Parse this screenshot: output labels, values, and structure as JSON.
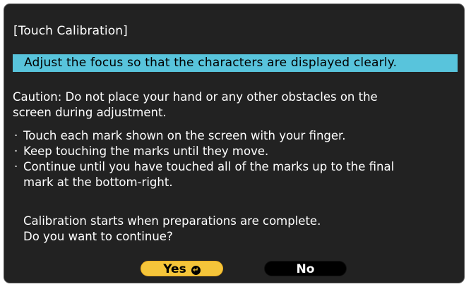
{
  "dialog": {
    "title": "[Touch Calibration]",
    "highlight": "Adjust the focus so that the characters are displayed clearly.",
    "caution_lines": [
      "Caution: Do not place your hand or any other obstacles on the",
      "screen during adjustment."
    ],
    "bullets": [
      {
        "marker": "·",
        "lines": [
          "Touch each mark shown on the screen with your finger."
        ]
      },
      {
        "marker": "·",
        "lines": [
          "Keep touching the marks until they move."
        ]
      },
      {
        "marker": "·",
        "lines": [
          "Continue until you have touched all of the marks up to the final",
          "mark at the bottom-right."
        ]
      }
    ],
    "prompt_lines": [
      "Calibration starts when preparations are complete.",
      "Do you want to continue?"
    ],
    "buttons": {
      "yes_label": "Yes",
      "enter_icon": "enter-icon",
      "no_label": "No"
    }
  },
  "colors": {
    "dialog_bg": "#222222",
    "highlight_bg": "#58c4dc",
    "yes_bg": "#f5c53a",
    "no_bg": "#000000",
    "text": "#ffffff"
  }
}
